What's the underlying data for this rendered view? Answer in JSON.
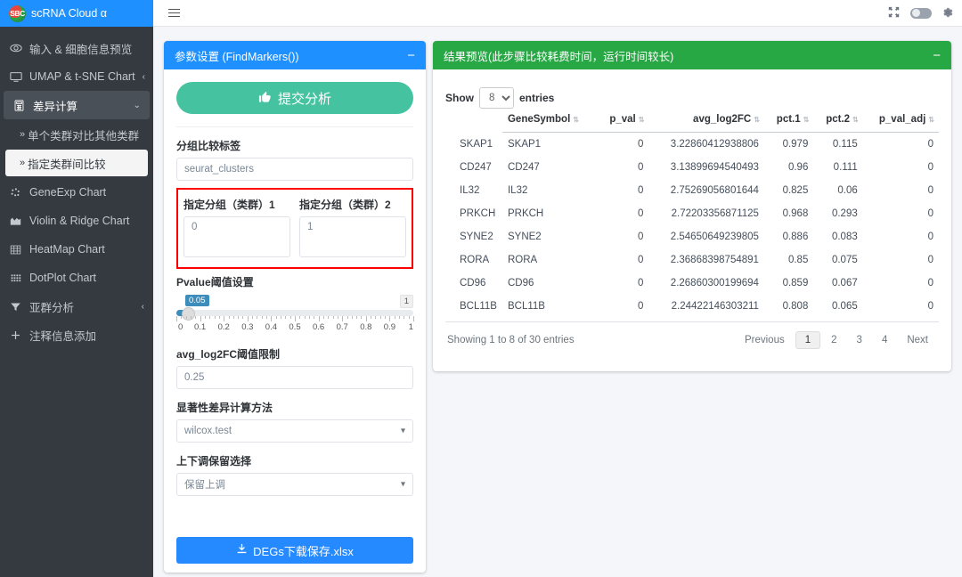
{
  "brand": {
    "logo_text": "SBC",
    "title": "scRNA Cloud α"
  },
  "topbar": {
    "menu_icon": "hamburger-icon",
    "expand_icon": "expand-arrows-icon",
    "gear_icon": "gear-icon",
    "toggle_state": "off"
  },
  "sidebar": {
    "items": [
      {
        "label": "输入 & 细胞信息预览",
        "icon": "eye-icon",
        "caret": ""
      },
      {
        "label": "UMAP & t-SNE Chart",
        "icon": "monitor-icon",
        "caret": "‹"
      },
      {
        "label": "差异计算",
        "icon": "calculator-icon",
        "caret": "⌵"
      },
      {
        "label": "GeneExp Chart",
        "icon": "scatter-icon",
        "caret": ""
      },
      {
        "label": "Violin & Ridge Chart",
        "icon": "area-chart-icon",
        "caret": ""
      },
      {
        "label": "HeatMap Chart",
        "icon": "grid-icon",
        "caret": ""
      },
      {
        "label": "DotPlot Chart",
        "icon": "dot-matrix-icon",
        "caret": ""
      },
      {
        "label": "亚群分析",
        "icon": "filter-icon",
        "caret": "‹"
      },
      {
        "label": "注释信息添加",
        "icon": "plus-icon",
        "caret": ""
      }
    ],
    "sub_items": [
      {
        "label": "单个类群对比其他类群",
        "arrow": "»"
      },
      {
        "label": "指定类群间比较",
        "arrow": "»"
      }
    ]
  },
  "params_panel": {
    "title": "参数设置 (FindMarkers())",
    "collapse_icon": "−",
    "submit_label": "提交分析",
    "submit_icon": "thumbs-up-icon",
    "group_label_title": "分组比较标签",
    "group_label_value": "seurat_clusters",
    "cluster1_title": "指定分组（类群）1",
    "cluster1_value": "0",
    "cluster2_title": "指定分组（类群）2",
    "cluster2_value": "1",
    "pvalue_title": "Pvalue阈值设置",
    "pvalue_current": "0.05",
    "pvalue_max": "1",
    "slider_ticks": [
      "0",
      "0.1",
      "0.2",
      "0.3",
      "0.4",
      "0.5",
      "0.6",
      "0.7",
      "0.8",
      "0.9",
      "1"
    ],
    "log2fc_title": "avg_log2FC阈值限制",
    "log2fc_value": "0.25",
    "method_title": "显著性差异计算方法",
    "method_value": "wilcox.test",
    "regulation_title": "上下调保留选择",
    "regulation_value": "保留上调",
    "download_label": "DEGs下载保存.xlsx",
    "download_icon": "download-icon",
    "highlight_color": "#ff0000"
  },
  "results_panel": {
    "title": "结果预览(此步骤比较耗费时间，运行时间较长)",
    "collapse_icon": "−",
    "show_prefix": "Show",
    "show_value": "8",
    "show_suffix": "entries",
    "columns": [
      "",
      "GeneSymbol",
      "p_val",
      "avg_log2FC",
      "pct.1",
      "pct.2",
      "p_val_adj"
    ],
    "rows": [
      {
        "name": "SKAP1",
        "gene": "SKAP1",
        "p_val": "0",
        "avg_log2FC": "3.22860412938806",
        "pct1": "0.979",
        "pct2": "0.115",
        "p_val_adj": "0"
      },
      {
        "name": "CD247",
        "gene": "CD247",
        "p_val": "0",
        "avg_log2FC": "3.13899694540493",
        "pct1": "0.96",
        "pct2": "0.111",
        "p_val_adj": "0"
      },
      {
        "name": "IL32",
        "gene": "IL32",
        "p_val": "0",
        "avg_log2FC": "2.75269056801644",
        "pct1": "0.825",
        "pct2": "0.06",
        "p_val_adj": "0"
      },
      {
        "name": "PRKCH",
        "gene": "PRKCH",
        "p_val": "0",
        "avg_log2FC": "2.72203356871125",
        "pct1": "0.968",
        "pct2": "0.293",
        "p_val_adj": "0"
      },
      {
        "name": "SYNE2",
        "gene": "SYNE2",
        "p_val": "0",
        "avg_log2FC": "2.54650649239805",
        "pct1": "0.886",
        "pct2": "0.083",
        "p_val_adj": "0"
      },
      {
        "name": "RORA",
        "gene": "RORA",
        "p_val": "0",
        "avg_log2FC": "2.36868398754891",
        "pct1": "0.85",
        "pct2": "0.075",
        "p_val_adj": "0"
      },
      {
        "name": "CD96",
        "gene": "CD96",
        "p_val": "0",
        "avg_log2FC": "2.26860300199694",
        "pct1": "0.859",
        "pct2": "0.067",
        "p_val_adj": "0"
      },
      {
        "name": "BCL11B",
        "gene": "BCL11B",
        "p_val": "0",
        "avg_log2FC": "2.24422146303211",
        "pct1": "0.808",
        "pct2": "0.065",
        "p_val_adj": "0"
      }
    ],
    "summary": "Showing 1 to 8 of 30 entries",
    "pagination": {
      "previous": "Previous",
      "pages": [
        "1",
        "2",
        "3",
        "4"
      ],
      "current": "1",
      "next": "Next"
    }
  },
  "colors": {
    "brand_blue": "#1e90ff",
    "panel_green": "#28a745",
    "submit_green": "#45c3a0",
    "download_blue": "#2589ff",
    "sidebar_dark": "#343a40"
  }
}
